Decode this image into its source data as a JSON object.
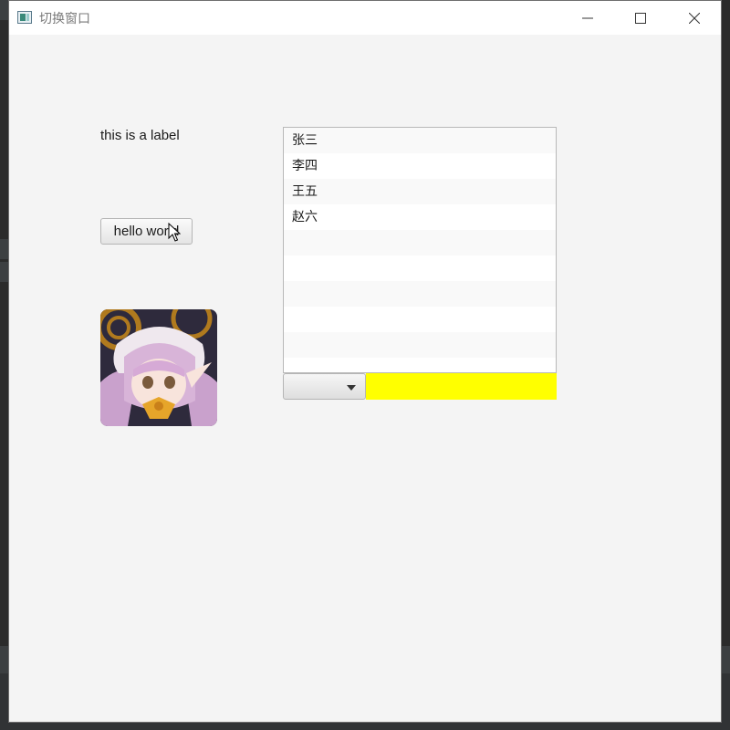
{
  "window": {
    "title": "切换窗口",
    "controls": {
      "minimize": "minimize-icon",
      "maximize": "maximize-icon",
      "close": "close-icon"
    }
  },
  "content": {
    "label": "this is a label",
    "button": {
      "label": "hello world"
    },
    "avatar_image": "anime-girl-avatar",
    "list": {
      "items": [
        "张三",
        "李四",
        "王五",
        "赵六",
        "",
        "",
        "",
        "",
        "",
        ""
      ]
    },
    "combo": {
      "value": ""
    },
    "yellow_panel_color": "#ffff00"
  }
}
